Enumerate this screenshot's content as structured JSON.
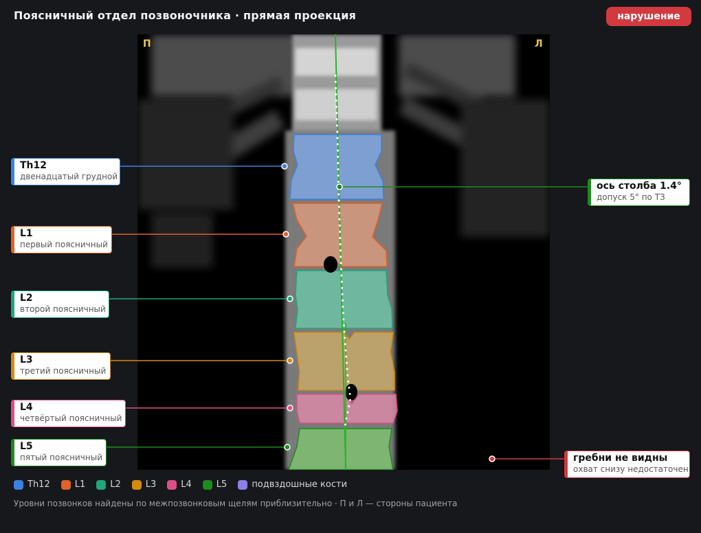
{
  "header": {
    "title": "Поясничный отдел позвоночника · прямая проекция",
    "status_badge": "нарушение"
  },
  "orientation": {
    "right_side": "П",
    "left_side": "Л"
  },
  "colors": {
    "Th12": "#3b82e0",
    "L1": "#e0612a",
    "L2": "#1fa67a",
    "L3": "#d48a0f",
    "L4": "#dc4f86",
    "L5": "#1c8c1c",
    "iliac": "#8b7fe8",
    "alert": "#d23a3f"
  },
  "vertebrae": [
    {
      "id": "Th12",
      "label": "Th12",
      "description": "двенадцатый грудной"
    },
    {
      "id": "L1",
      "label": "L1",
      "description": "первый поясничный"
    },
    {
      "id": "L2",
      "label": "L2",
      "description": "второй поясничный"
    },
    {
      "id": "L3",
      "label": "L3",
      "description": "третий поясничный"
    },
    {
      "id": "L4",
      "label": "L4",
      "description": "четвёртый поясничный"
    },
    {
      "id": "L5",
      "label": "L5",
      "description": "пятый поясничный"
    }
  ],
  "axis_callout": {
    "title": "ось столба 1.4°",
    "note": "допуск 5° по ТЗ"
  },
  "crest_callout": {
    "title": "гребни не видны",
    "note": "охват снизу недостаточен"
  },
  "legend": [
    "Th12",
    "L1",
    "L2",
    "L3",
    "L4",
    "L5",
    "подвздошные кости"
  ],
  "footnote": "Уровни позвонков найдены по межпозвонковым щелям приблизительно · П и Л — стороны пациента"
}
